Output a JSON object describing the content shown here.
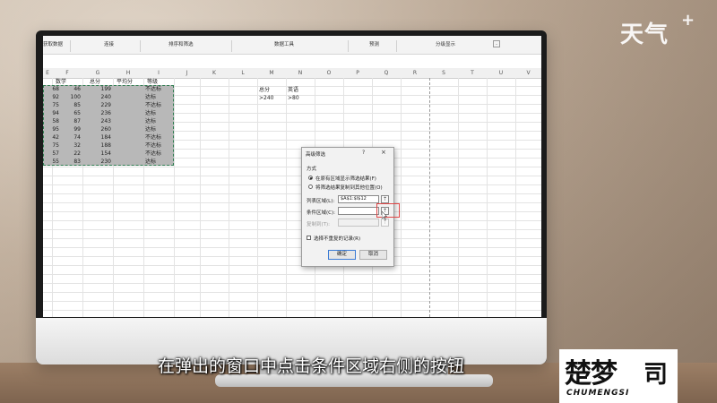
{
  "overlay": {
    "brand": "天气",
    "brand_plus": "+",
    "subtitle": "在弹出的窗口中点击条件区域右侧的按钮",
    "logo_main": "楚梦",
    "logo_mark": "司",
    "logo_sub": "CHUMENGSI"
  },
  "ribbon": {
    "items": [
      "获取数据",
      "连接",
      "排序和筛选",
      "数据工具",
      "预测",
      "分级显示"
    ]
  },
  "columns": [
    "E",
    "F",
    "G",
    "H",
    "I",
    "J",
    "K",
    "L",
    "M",
    "N",
    "O",
    "P",
    "Q",
    "R",
    "S",
    "T",
    "U",
    "V"
  ],
  "table": {
    "headers": [
      "数学",
      "总分",
      "平均分",
      "等级"
    ],
    "rows": [
      [
        "68",
        "46",
        "199",
        "",
        "不达标"
      ],
      [
        "92",
        "100",
        "240",
        "",
        "达标"
      ],
      [
        "75",
        "85",
        "229",
        "",
        "不达标"
      ],
      [
        "94",
        "65",
        "236",
        "",
        "达标"
      ],
      [
        "58",
        "87",
        "243",
        "",
        "达标"
      ],
      [
        "95",
        "99",
        "260",
        "",
        "达标"
      ],
      [
        "42",
        "74",
        "184",
        "",
        "不达标"
      ],
      [
        "75",
        "32",
        "188",
        "",
        "不达标"
      ],
      [
        "57",
        "22",
        "154",
        "",
        "不达标"
      ],
      [
        "55",
        "83",
        "230",
        "",
        "达标"
      ]
    ]
  },
  "criteria": {
    "headers": [
      "总分",
      "英语"
    ],
    "values": [
      ">240",
      ">80"
    ]
  },
  "dialog": {
    "title": "高级筛选",
    "help": "?",
    "close": "×",
    "mode_label": "方式",
    "option_inplace": "在原有区域显示筛选结果(F)",
    "option_copy": "将筛选结果复制到其他位置(O)",
    "list_range_label": "列表区域(L):",
    "list_range_value": "$A$1:$I$12",
    "criteria_range_label": "条件区域(C):",
    "criteria_range_value": "",
    "copy_to_label": "复制到(T):",
    "copy_to_value": "",
    "unique_label": "选择不重复的记录(R)",
    "ok": "确定",
    "cancel": "取消"
  }
}
